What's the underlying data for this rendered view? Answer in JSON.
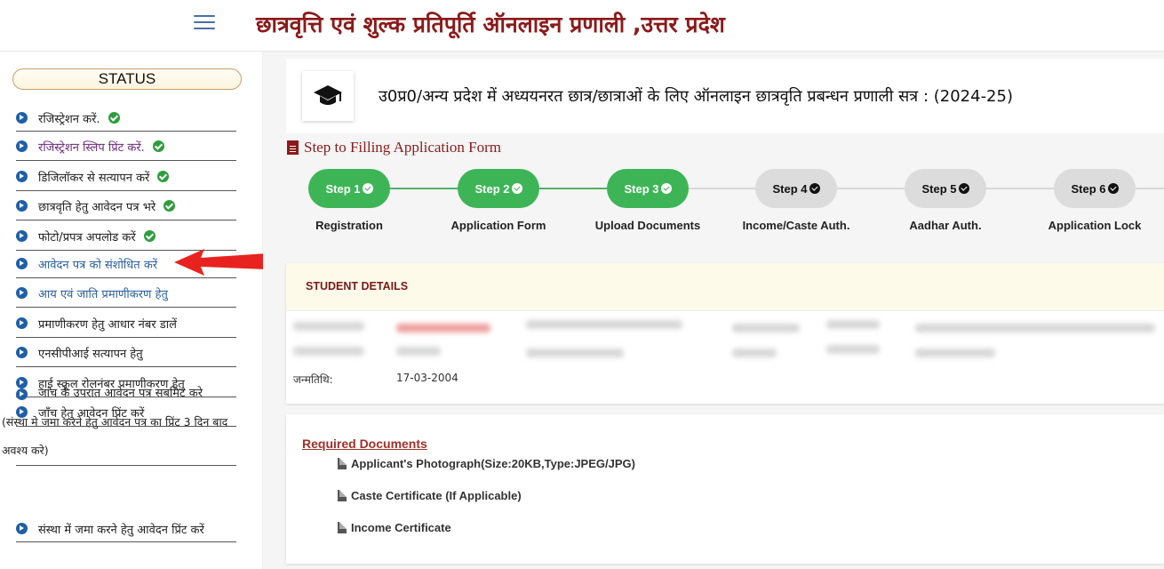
{
  "header": {
    "site_title": "छात्रवृत्ति एवं शुल्क प्रतिपूर्ति ऑनलाइन प्रणाली ,उत्तर प्रदेश",
    "menu_icon": "hamburger-icon"
  },
  "sidebar": {
    "status_label": "STATUS",
    "items": [
      {
        "label": "रजिस्ट्रेशन करें.",
        "done": true
      },
      {
        "label": "रजिस्ट्रेशन स्लिप प्रिंट करें.",
        "done": true
      },
      {
        "label": "डिजिलॉकर से सत्यापन करें",
        "done": true
      },
      {
        "label": "छात्रवृति हेतु आवेदन पत्र भरे",
        "done": true
      },
      {
        "label": "फोटो/प्रपत्र अपलोड करें",
        "done": true
      },
      {
        "label": "आवेदन पत्र को संशोधित करें",
        "done": false
      },
      {
        "label": "आय एवं जाति प्रमाणीकरण हेतु",
        "done": false
      },
      {
        "label": "प्रमाणीकरण हेतु आधार नंबर डालें",
        "done": false
      },
      {
        "label": "एनसीपीआई सत्यापन हेतु",
        "done": false
      },
      {
        "label": "हाई स्कूल रोलनंबर प्रमाणीकरण हेतु",
        "done": false
      },
      {
        "label": "जाँच हेतु आवेदन प्रिंट करें",
        "done": false
      },
      {
        "label": "जांच के उपरांत आवेदन पत्र सबमिट करे",
        "done": false
      },
      {
        "label": "संस्था में जमा करने हेतु आवेदन प्रिंट करें",
        "done": false
      }
    ],
    "submit_note": "(संस्था मे जमा करने हेतु आवेदन पत्र का प्रिंट 3 दिन बाद अवश्य करे)"
  },
  "main": {
    "portal_title": "उ0प्र0/अन्य प्रदेश में अध्ययनरत छात्र/छात्राओं के लिए ऑनलाइन छात्रवृति प्रबन्धन प्रणाली सत्र : (2024-25)",
    "steps_heading": "Step to Filling Application Form",
    "steps": [
      {
        "badge": "Step 1",
        "label": "Registration",
        "done": true
      },
      {
        "badge": "Step 2",
        "label": "Application Form",
        "done": true
      },
      {
        "badge": "Step 3",
        "label": "Upload Documents",
        "done": true
      },
      {
        "badge": "Step 4",
        "label": "Income/Caste Auth.",
        "done": false
      },
      {
        "badge": "Step 5",
        "label": "Aadhar Auth.",
        "done": false
      },
      {
        "badge": "Step 6",
        "label": "Application Lock",
        "done": false
      }
    ],
    "student_details_title": "STUDENT DETAILS",
    "dob_label": "जन्मतिथि:",
    "dob_value": "17-03-2004",
    "required_docs_title": "Required Documents",
    "required_docs": [
      "Applicant's Photograph(Size:20KB,Type:JPEG/JPG)",
      "Caste Certificate (If Applicable)",
      "Income Certificate"
    ]
  },
  "colors": {
    "title": "#8b1a1a",
    "step_done": "#3db556",
    "step_pending": "#dcdcdc",
    "arrow": "#e8231f"
  }
}
